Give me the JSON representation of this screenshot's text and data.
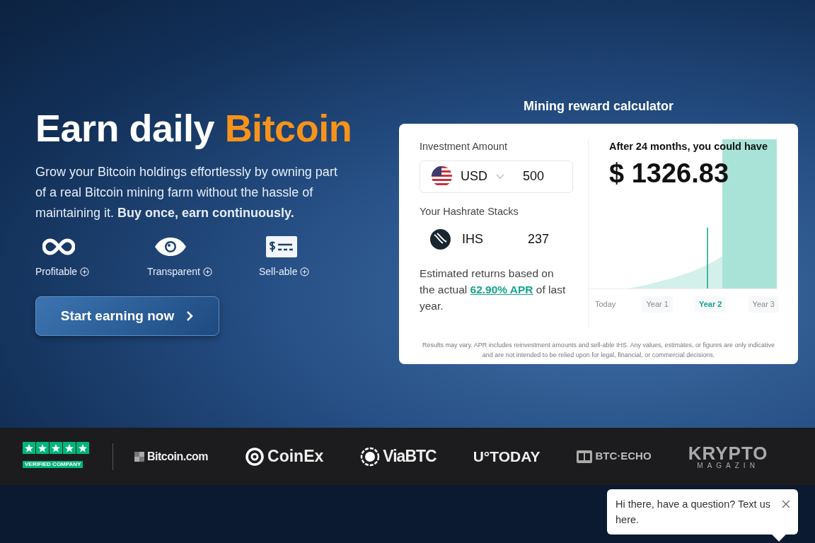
{
  "hero": {
    "headline": "Earn daily",
    "highlight": "Bitcoin",
    "description": "Grow your Bitcoin holdings effortlessly by owning part of a real Bitcoin mining farm without the hassle of maintaining it. **Buy once, earn continuously.**",
    "features": [
      {
        "kind": "infinity",
        "label": "Profitable"
      },
      {
        "kind": "eye",
        "label": "Transparent"
      },
      {
        "kind": "bill",
        "label": "Sell-able"
      }
    ],
    "cta": "Start earning now"
  },
  "calculator": {
    "title": "Mining reward calculator",
    "investment_label": "Investment Amount",
    "currency": "USD",
    "amount": "500",
    "hashrate_label": "Your Hashrate Stacks",
    "hashrate_unit": "IHS",
    "hashrate_value": "237",
    "returns": {
      "before": "Estimated returns based on the actual",
      "link": "62.90% APR",
      "after": "of last year."
    },
    "result_label": "After 24 months, you could have",
    "result_value": "$ 1326.83",
    "periods": [
      {
        "label": "Today",
        "selected": false
      },
      {
        "label": "Year 1",
        "selected": false
      },
      {
        "label": "Year 2",
        "selected": true
      },
      {
        "label": "Year 3",
        "selected": false
      }
    ],
    "disclaimer": "Results may vary. APR includes reinvestment amounts and sell-able IHS. Any values, estimates, or figures are only indicative and are not intended to be relied upon for legal, financial, or commercial decisions."
  },
  "press": {
    "rating": {
      "stars": 5,
      "caption": "VERIFIED COMPANY"
    },
    "logos": [
      {
        "kind": "bitcoincom",
        "text": "Bitcoin.com"
      },
      {
        "kind": "coinex",
        "text": "CoinEx"
      },
      {
        "kind": "viabtc",
        "text": "ViaBTC"
      },
      {
        "kind": "utoday",
        "text": "U°TODAY"
      },
      {
        "kind": "btcecho",
        "text": "BTC·ECHO"
      },
      {
        "kind": "krypto",
        "text": "KRYPTO",
        "subtext": "MAGAZIN"
      }
    ]
  },
  "chat": {
    "message": "Hi there, have a question? Text us here."
  }
}
